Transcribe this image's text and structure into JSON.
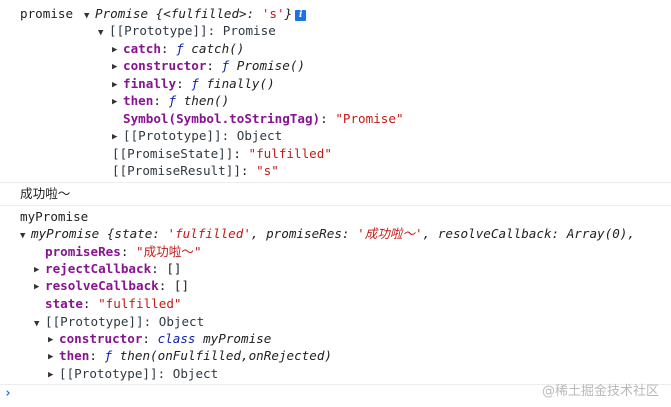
{
  "log1": {
    "label": "promise",
    "summary_prefix": "Promise {<fulfilled>: ",
    "summary_value": "'s'",
    "summary_suffix": "}",
    "info_icon": "i",
    "proto_label": "[[Prototype]]: Promise",
    "proto_items": [
      {
        "key": "catch",
        "f": "ƒ",
        "sig": "catch()"
      },
      {
        "key": "constructor",
        "f": "ƒ",
        "sig": "Promise()"
      },
      {
        "key": "finally",
        "f": "ƒ",
        "sig": "finally()"
      },
      {
        "key": "then",
        "f": "ƒ",
        "sig": "then()"
      }
    ],
    "tostringtag_key": "Symbol(Symbol.toStringTag)",
    "tostringtag_value": "\"Promise\"",
    "proto_proto": "[[Prototype]]: Object",
    "state_key": "[[PromiseState]]",
    "state_value": "\"fulfilled\"",
    "result_key": "[[PromiseResult]]",
    "result_value": "\"s\""
  },
  "log2": {
    "text": "成功啦～"
  },
  "log3": {
    "label": "myPromise",
    "summary_name": "myPromise ",
    "summary_open": "{",
    "summary_k1": "state",
    "summary_v1": "'fulfilled'",
    "summary_k2": "promiseRes",
    "summary_v2": "'成功啦～'",
    "summary_k3": "resolveCallback",
    "summary_v3": "Array(0),",
    "props": {
      "promiseRes_key": "promiseRes",
      "promiseRes_value": "\"成功啦～\"",
      "reject_key": "rejectCallback",
      "reject_value": "[]",
      "resolve_key": "resolveCallback",
      "resolve_value": "[]",
      "state_key": "state",
      "state_value": "\"fulfilled\""
    },
    "proto_label": "[[Prototype]]: Object",
    "proto_items": {
      "constructor_key": "constructor",
      "constructor_kw": "class",
      "constructor_name": "myPromise",
      "then_key": "then",
      "then_f": "ƒ",
      "then_sig": "then(onFulfilled,onRejected)",
      "proto_proto": "[[Prototype]]: Object"
    }
  },
  "watermark": "@稀土掘金技术社区",
  "prompt_glyph": "›"
}
